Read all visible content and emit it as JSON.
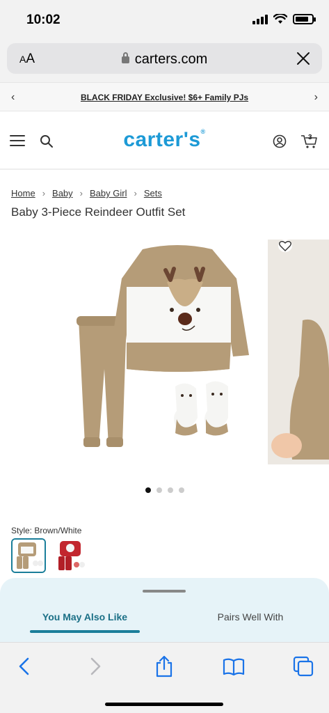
{
  "status": {
    "time": "10:02"
  },
  "browser": {
    "text_size": "AA",
    "url": "carters.com"
  },
  "promo": {
    "text": "BLACK FRIDAY Exclusive! $6+ Family PJs",
    "prev": "‹",
    "next": "›"
  },
  "header": {
    "logo": "carter's",
    "cart_count": "3"
  },
  "breadcrumb": [
    "Home",
    "Baby",
    "Baby Girl",
    "Sets"
  ],
  "product": {
    "title": "Baby 3-Piece Reindeer Outfit Set",
    "style_label": "Style: Brown/White",
    "image_count": 4,
    "active_image": 0
  },
  "sheet": {
    "tab_active": "You May Also Like",
    "tab_other": "Pairs Well With"
  },
  "colors": {
    "brand": "#1d9ad6",
    "accent": "#1a7e9a",
    "sheet_bg": "#e6f3f8"
  },
  "toolbar": {
    "icons": [
      "back-icon",
      "forward-icon",
      "share-icon",
      "bookmarks-icon",
      "tabs-icon"
    ]
  }
}
